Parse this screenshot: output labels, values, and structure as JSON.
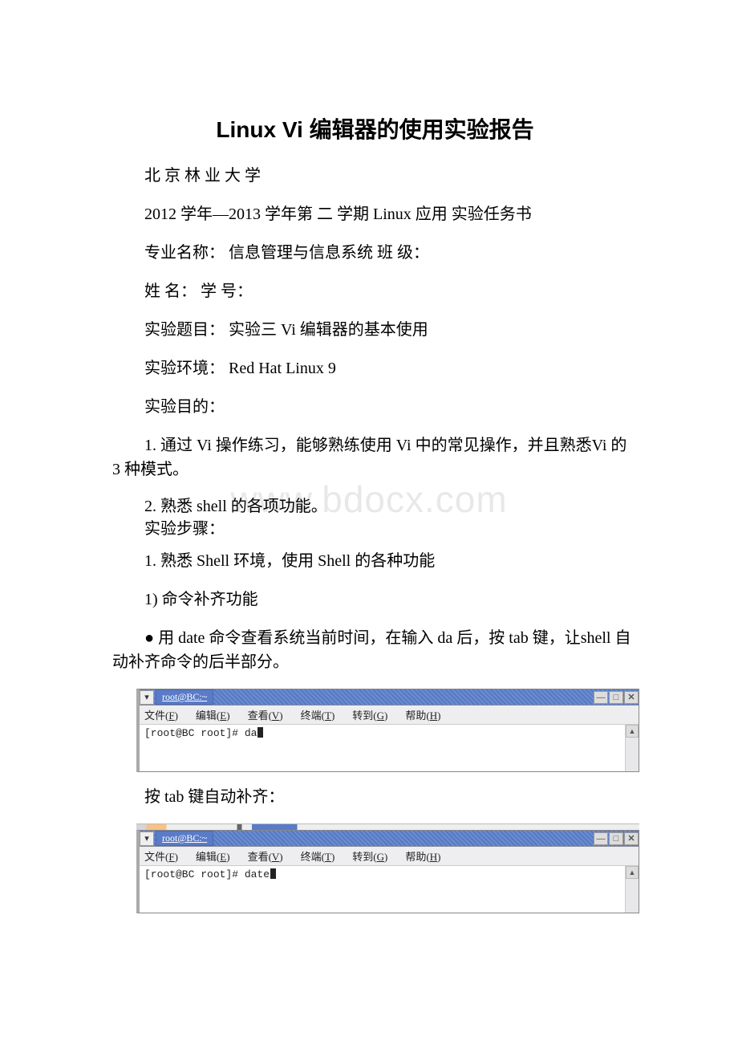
{
  "title": "Linux Vi 编辑器的使用实验报告",
  "watermark": "www.bdocx.com",
  "body": {
    "school": "北 京 林 业 大 学",
    "semester": "2012 学年—2013 学年第 二 学期 Linux 应用 实验任务书",
    "major": "专业名称： 信息管理与信息系统  班 级：",
    "name_id": "姓 名：   学 号：",
    "exp_title": "实验题目：  实验三 Vi 编辑器的基本使用",
    "exp_env": "实验环境：  Red Hat Linux 9",
    "exp_goal_label": "实验目的：",
    "goal1": "1. 通过 Vi 操作练习，能够熟练使用 Vi 中的常见操作，并且熟悉Vi 的 3 种模式。",
    "goal2": "2. 熟悉 shell 的各项功能。",
    "steps_label": "实验步骤：",
    "step1": "1. 熟悉 Shell 环境，使用 Shell 的各种功能",
    "step1_1": "1) 命令补齐功能",
    "date_desc": "● 用 date 命令查看系统当前时间，在输入 da 后，按 tab 键，让shell 自动补齐命令的后半部分。",
    "after_tab": "按 tab 键自动补齐："
  },
  "terminal": {
    "tab_title": "root@BC:~",
    "menu": {
      "file": "文件(F)",
      "edit": "编辑(E)",
      "view": "查看(V)",
      "term": "终端(T)",
      "goto": "转到(G)",
      "help": "帮助(H)"
    },
    "prompt1": "[root@BC root]# da",
    "prompt2": "[root@BC root]# date"
  }
}
